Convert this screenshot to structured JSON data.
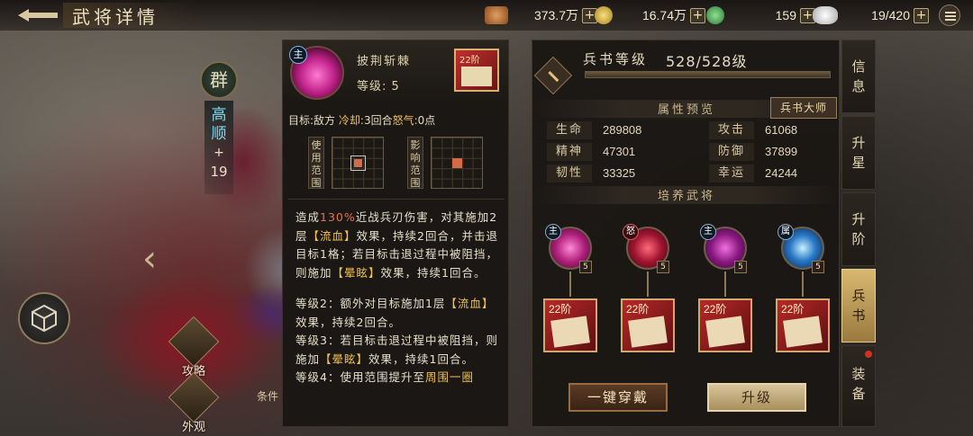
{
  "header": {
    "title": "武将详情"
  },
  "resources": [
    {
      "icon": "ingot-icon",
      "value": "373.7万"
    },
    {
      "icon": "gold-coin-icon",
      "value": "16.74万"
    },
    {
      "icon": "jade-coin-icon",
      "value": "159"
    },
    {
      "icon": "silver-icon",
      "value": "19/420"
    }
  ],
  "hero": {
    "faction": "群",
    "name_chars": [
      "高",
      "顺",
      "+",
      "19"
    ]
  },
  "side_buttons": {
    "strategy": "攻略",
    "appearance": "外观"
  },
  "skill_condition": "条件",
  "skill_tip": {
    "name": "披荆斩棘",
    "level": "等级: 5",
    "main_tag": "主",
    "book_stage": "22阶",
    "target_label": "目标:",
    "target_value": "敌方",
    "cooldown_label": "冷却:",
    "cooldown_value": "3回合",
    "rage_label": "怒气:",
    "rage_value": "0点",
    "use_range_label": [
      "使",
      "用",
      "范",
      "围"
    ],
    "effect_range_label": [
      "影",
      "响",
      "范",
      "围"
    ],
    "desc": {
      "p1": [
        "造成",
        "130%",
        "近战兵刃伤害，对其施加2层",
        "【流血】",
        "效果，持续2回合，并击退目标1格；若目标击退过程中被阻挡，则施加",
        "【晕眩】",
        "效果，持续1回合。"
      ],
      "lv2": [
        "等级2：额外对目标施加1层",
        "【流血】",
        "效果，持续2回合。"
      ],
      "lv3": [
        "等级3：若目标击退过程中被阻挡，则施加",
        "【晕眩】",
        "效果，持续1回合。"
      ],
      "lv4": [
        "等级4：使用范围提升至",
        "周围一圈"
      ]
    }
  },
  "book_panel": {
    "progress_label": "兵书等级",
    "progress_text": "528/528级",
    "progress_fraction": 1.0,
    "master_button": "兵书大师",
    "attr_title": "属性预览",
    "attrs": [
      {
        "k": "生命",
        "v": "289808"
      },
      {
        "k": "攻击",
        "v": "61068"
      },
      {
        "k": "精神",
        "v": "47301"
      },
      {
        "k": "防御",
        "v": "37899"
      },
      {
        "k": "韧性",
        "v": "33325"
      },
      {
        "k": "幸运",
        "v": "24244"
      }
    ],
    "cultivate_title": "培养武将",
    "generals": [
      {
        "type": "主",
        "level": "5",
        "stage": "22阶",
        "orb": "pink"
      },
      {
        "type": "怒",
        "level": "5",
        "stage": "22阶",
        "orb": "crimson"
      },
      {
        "type": "主",
        "level": "5",
        "stage": "22阶",
        "orb": "magenta"
      },
      {
        "type": "属",
        "level": "5",
        "stage": "22阶",
        "orb": "blue"
      }
    ],
    "equip_all": "一键穿戴",
    "upgrade": "升级"
  },
  "tabs": [
    {
      "chars": [
        "信",
        "息"
      ]
    },
    {
      "chars": [
        "升",
        "星"
      ]
    },
    {
      "chars": [
        "升",
        "阶"
      ]
    },
    {
      "chars": [
        "兵",
        "书"
      ]
    },
    {
      "chars": [
        "装",
        "备"
      ]
    }
  ],
  "colors": {
    "highlight": "#e87050",
    "bracket": "#f0c050",
    "active_tab": "#d8b870"
  }
}
